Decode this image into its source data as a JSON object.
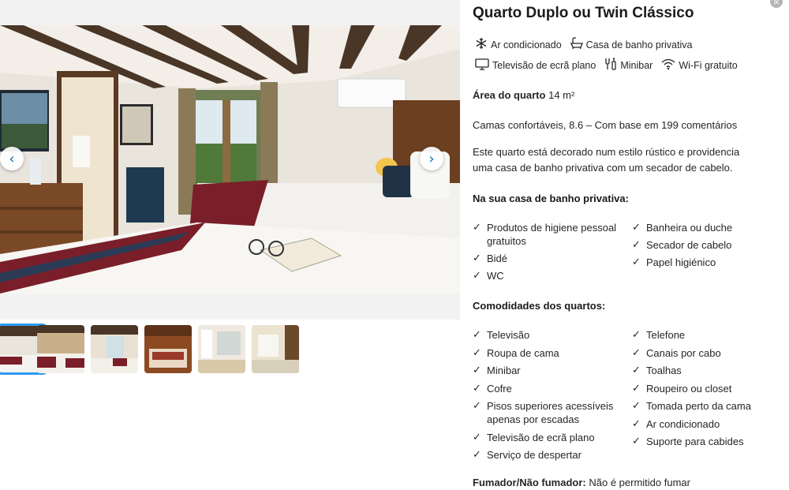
{
  "room": {
    "title": "Quarto Duplo ou Twin Clássico"
  },
  "facilities": [
    {
      "label": "Ar condicionado",
      "icon": "snowflake-icon"
    },
    {
      "label": "Casa de banho privativa",
      "icon": "bath-icon"
    },
    {
      "label": "Televisão de ecrã plano",
      "icon": "tv-icon"
    },
    {
      "label": "Minibar",
      "icon": "minibar-icon"
    },
    {
      "label": "Wi-Fi gratuito",
      "icon": "wifi-icon"
    }
  ],
  "area": {
    "label": "Área do quarto",
    "value": "14 m²"
  },
  "beds": "Camas confortáveis, 8.6 – Com base em 199 comentários",
  "description": {
    "line1": "Este quarto está decorado num estilo rústico e providencia",
    "line2": "uma casa de banho privativa com um secador de cabelo."
  },
  "bathroom": {
    "title": "Na sua casa de banho privativa:",
    "left": [
      "Produtos de higiene pessoal gratuitos",
      "Bidé",
      "WC"
    ],
    "right": [
      "Banheira ou duche",
      "Secador de cabelo",
      "Papel higiénico"
    ]
  },
  "amenities": {
    "title": "Comodidades dos quartos:",
    "left": [
      "Televisão",
      "Roupa de cama",
      "Minibar",
      "Cofre",
      "Pisos superiores acessíveis apenas por escadas",
      "Televisão de ecrã plano",
      "Serviço de despertar"
    ],
    "right": [
      "Telefone",
      "Canais por cabo",
      "Toalhas",
      "Roupeiro ou closet",
      "Tomada perto da cama",
      "Ar condicionado",
      "Suporte para cabides"
    ]
  },
  "smoking": {
    "label": "Fumador/Não fumador:",
    "value": "Não é permitido fumar"
  },
  "gallery": {
    "prev_glyph": "‹",
    "next_glyph": "›",
    "close_glyph": "×",
    "thumbnail_count": 6,
    "active_thumbnail": 1
  },
  "colors": {
    "accent": "#0071c2",
    "active_thumb": "#2e9bf0"
  }
}
